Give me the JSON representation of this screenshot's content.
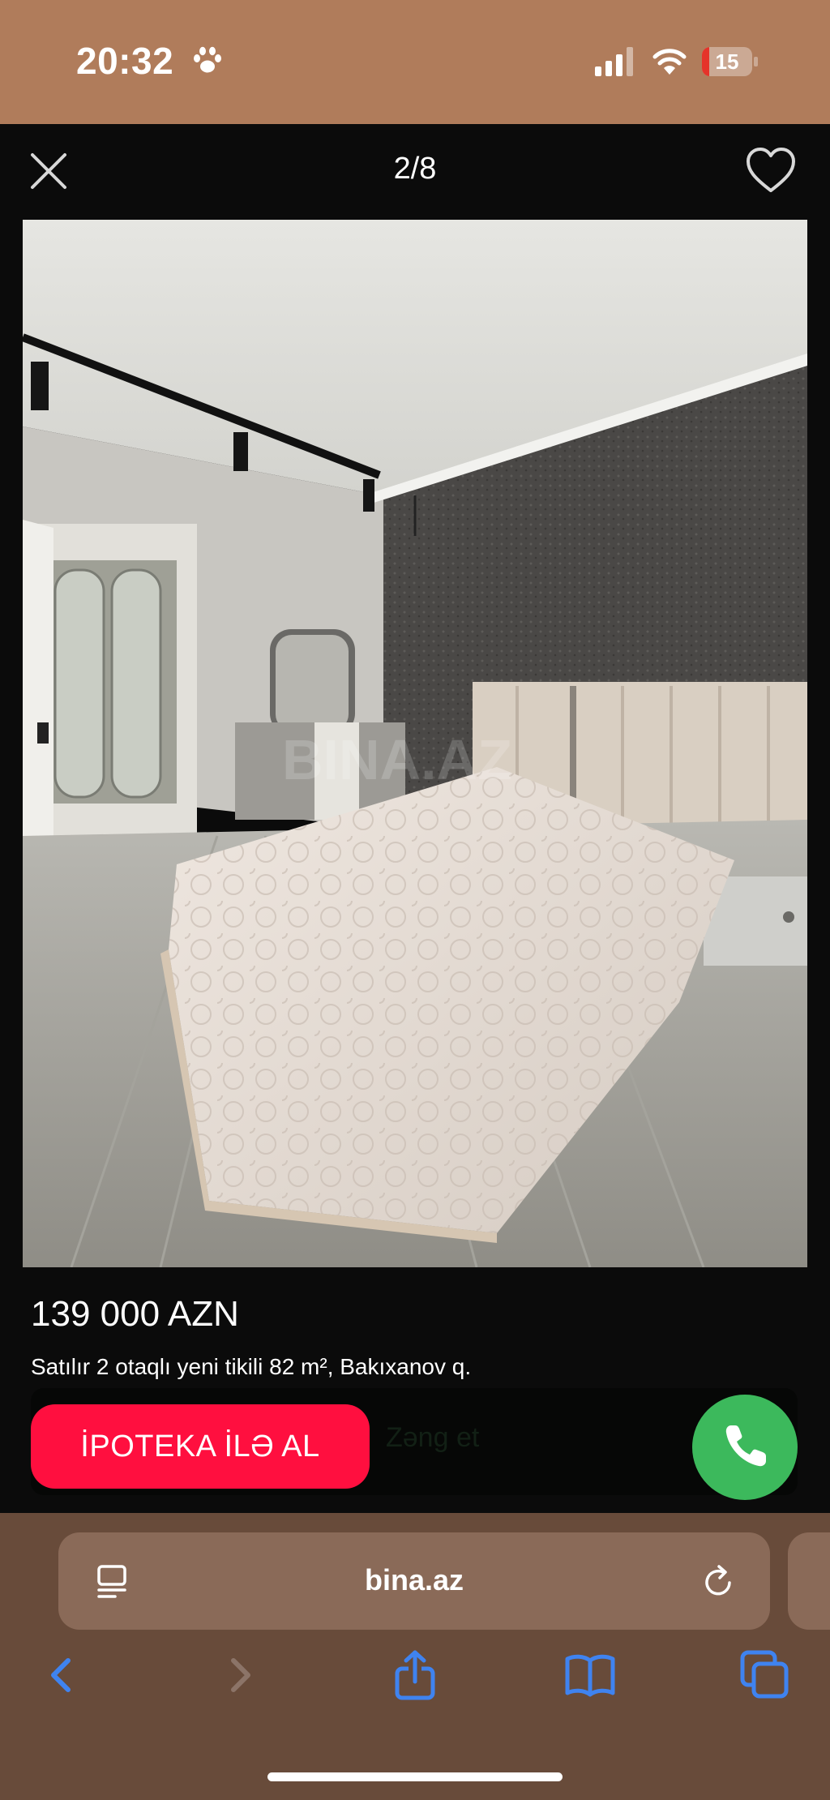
{
  "status_bar": {
    "time": "20:32",
    "battery": "15",
    "battery_level": 0.15,
    "icons": [
      "paw-icon",
      "signal-icon",
      "wifi-icon",
      "battery-icon"
    ]
  },
  "viewer": {
    "counter": "2/8",
    "icons": [
      "close-icon",
      "heart-icon"
    ]
  },
  "photo": {
    "watermark": "BINA.AZ"
  },
  "listing": {
    "price": "139 000 AZN",
    "description": "Satılır 2 otaqlı yeni tikili 82 m², Bakıxanov q."
  },
  "actions": {
    "mortgage_label": "İPOTEKA İLƏ AL",
    "call_label": "Zəng et",
    "icons": [
      "phone-icon"
    ]
  },
  "browser": {
    "url": "bina.az",
    "icons": [
      "reader-icon",
      "reload-icon",
      "back-icon",
      "forward-icon",
      "share-icon",
      "bookmarks-icon",
      "tabs-icon"
    ]
  },
  "colors": {
    "status_bg": "#b07c5b",
    "mortgage": "#ff0f3f",
    "call": "#3cb95c",
    "toolbar_icons": "#3f83f0",
    "browser_bg": "#684b3a"
  }
}
